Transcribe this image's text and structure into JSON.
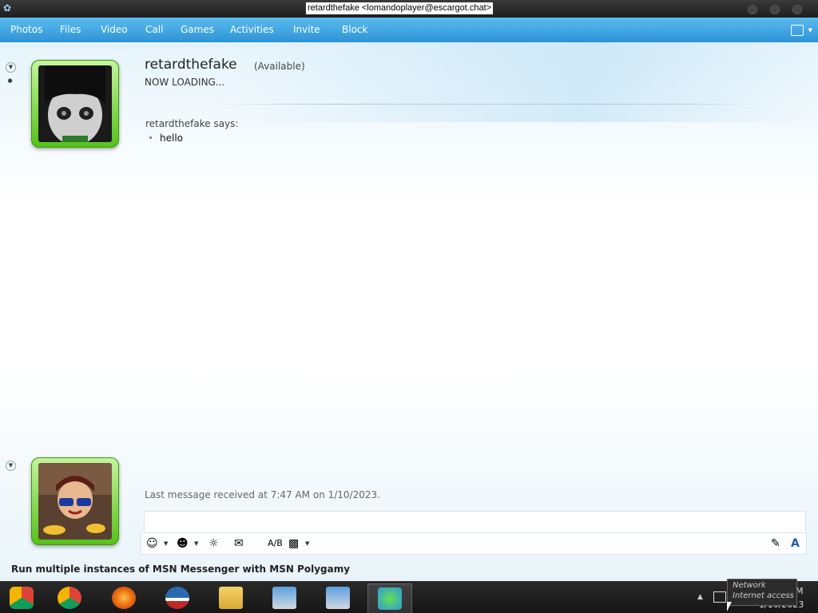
{
  "window": {
    "title": "retardthefake <lomandoplayer@escargot.chat>"
  },
  "menu": {
    "items": [
      "Photos",
      "Files",
      "Video",
      "Call",
      "Games",
      "Activities",
      "Invite",
      "Block"
    ]
  },
  "contact": {
    "name": "retardthefake",
    "status": "(Available)",
    "personal_message": "NOW LOADING..."
  },
  "conversation": {
    "sender_line": "retardthefake says:",
    "messages": [
      "hello"
    ],
    "last_received": "Last message received at 7:47 AM on 1/10/2023."
  },
  "promo": {
    "text": "Run multiple instances of MSN Messenger with MSN Polygamy"
  },
  "taskbar": {
    "apps": [
      "chrome-icon",
      "chrome-icon",
      "firefox-icon",
      "obama-icon",
      "file-explorer-icon",
      "installer-icon",
      "installer-icon",
      "msn-messenger-icon"
    ]
  },
  "tray": {
    "tooltip_title": "Network",
    "tooltip_sub": "Internet access",
    "clock_time_fragment": "M",
    "clock_date": "1/10/2023"
  },
  "colors": {
    "menubar": "#3ba6e2",
    "avatar_frame": "#55c21a",
    "taskbar": "#1e1e1e"
  }
}
